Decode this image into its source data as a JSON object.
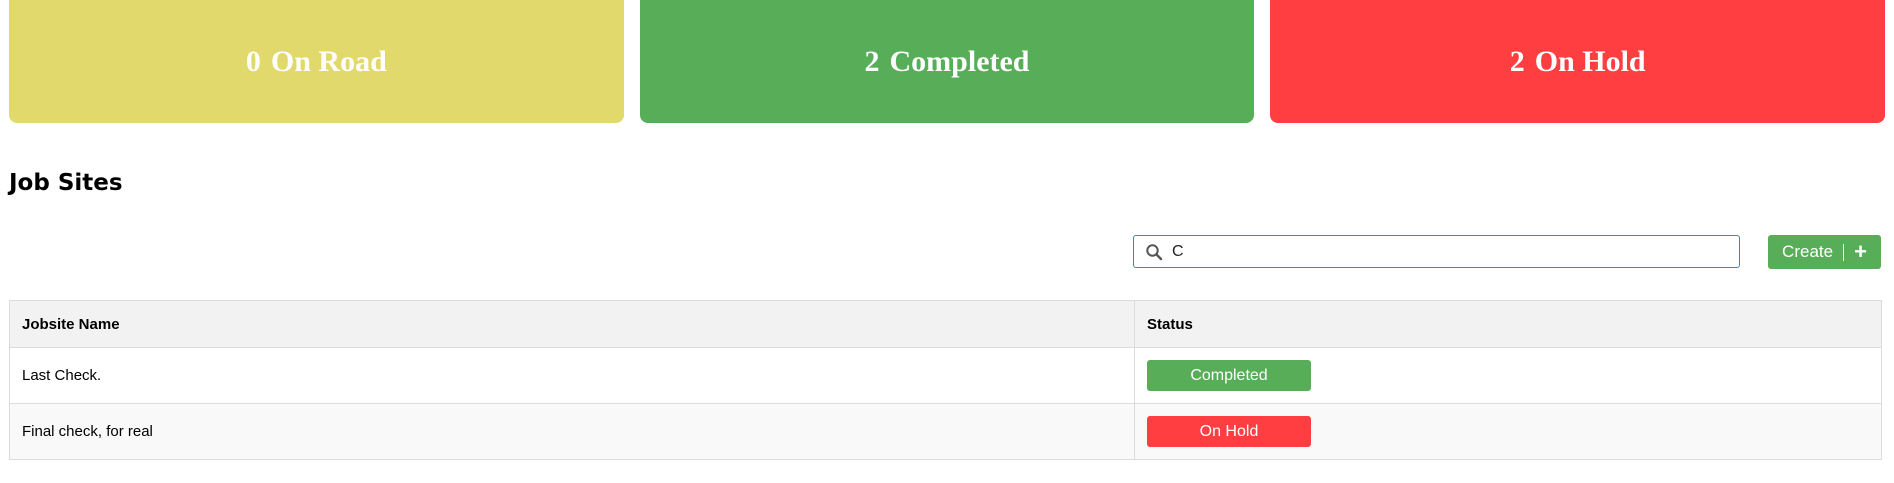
{
  "summary_cards": [
    {
      "count": "0",
      "label": "On Road",
      "color": "#e2d96c"
    },
    {
      "count": "2",
      "label": "Completed",
      "color": "#58ad59"
    },
    {
      "count": "2",
      "label": "On Hold",
      "color": "#ff3e42"
    }
  ],
  "section": {
    "title": "Job Sites"
  },
  "search": {
    "value": "C",
    "placeholder": "",
    "icon": "search-icon"
  },
  "create_button": {
    "label": "Create",
    "icon": "plus-icon"
  },
  "table": {
    "columns": [
      "Jobsite Name",
      "Status"
    ],
    "rows": [
      {
        "name": "Last Check.",
        "status": "Completed",
        "status_color": "#58ad59"
      },
      {
        "name": "Final check, for real",
        "status": "On Hold",
        "status_color": "#ff3e42"
      }
    ]
  }
}
